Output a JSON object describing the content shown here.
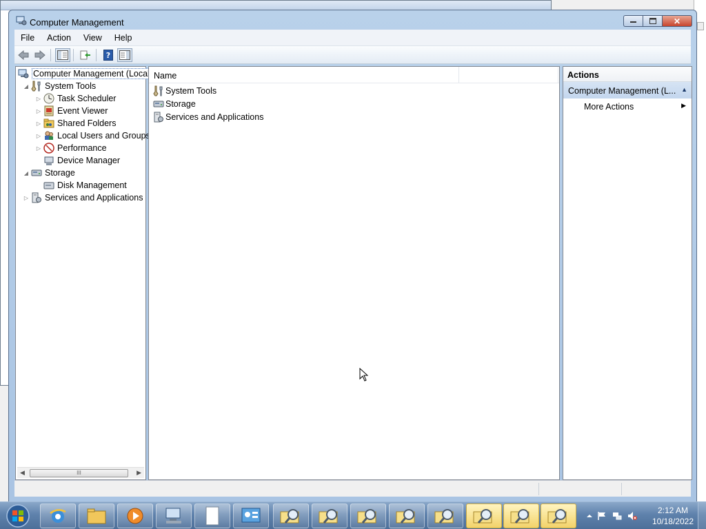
{
  "window": {
    "title": "Computer Management",
    "controls": {
      "minimize": "minimize",
      "maximize": "maximize",
      "close": "close"
    }
  },
  "menu": [
    "File",
    "Action",
    "View",
    "Help"
  ],
  "toolbar": [
    "back-icon",
    "forward-icon",
    "show-hide-tree-icon",
    "export-list-icon",
    "help-icon",
    "properties-icon"
  ],
  "tree": {
    "root": "Computer Management (Local",
    "items": [
      {
        "label": "System Tools",
        "icon": "tools-icon",
        "level": 1,
        "expander": "expanded"
      },
      {
        "label": "Task Scheduler",
        "icon": "clock-icon",
        "level": 2,
        "expander": "collapsed"
      },
      {
        "label": "Event Viewer",
        "icon": "event-viewer-icon",
        "level": 2,
        "expander": "collapsed"
      },
      {
        "label": "Shared Folders",
        "icon": "shared-folder-icon",
        "level": 2,
        "expander": "collapsed"
      },
      {
        "label": "Local Users and Groups",
        "icon": "users-icon",
        "level": 2,
        "expander": "collapsed"
      },
      {
        "label": "Performance",
        "icon": "performance-icon",
        "level": 2,
        "expander": "collapsed"
      },
      {
        "label": "Device Manager",
        "icon": "device-manager-icon",
        "level": 2,
        "expander": "none"
      },
      {
        "label": "Storage",
        "icon": "storage-icon",
        "level": 1,
        "expander": "expanded"
      },
      {
        "label": "Disk Management",
        "icon": "disk-icon",
        "level": 2,
        "expander": "none"
      },
      {
        "label": "Services and Applications",
        "icon": "services-icon",
        "level": 1,
        "expander": "collapsed"
      }
    ],
    "scroll_thumb_glyph": "III"
  },
  "list": {
    "column": "Name",
    "items": [
      {
        "label": "System Tools",
        "icon": "tools-icon"
      },
      {
        "label": "Storage",
        "icon": "storage-icon"
      },
      {
        "label": "Services and Applications",
        "icon": "services-icon"
      }
    ]
  },
  "actions": {
    "title": "Actions",
    "section": "Computer Management (L...",
    "items": [
      "More Actions"
    ]
  },
  "taskbar": {
    "pinned": [
      "internet-explorer-icon",
      "explorer-folder-icon",
      "media-player-icon",
      "computer-management-icon",
      "document-icon",
      "control-panel-icon"
    ],
    "search_windows": 8,
    "active_search_windows": [
      5,
      6,
      7
    ]
  },
  "tray": {
    "time": "2:12 AM",
    "date": "10/18/2022"
  },
  "colors": {
    "accent": "#3a6ea5",
    "taskbar": "#5f82ac",
    "close_button": "#c7442c"
  }
}
